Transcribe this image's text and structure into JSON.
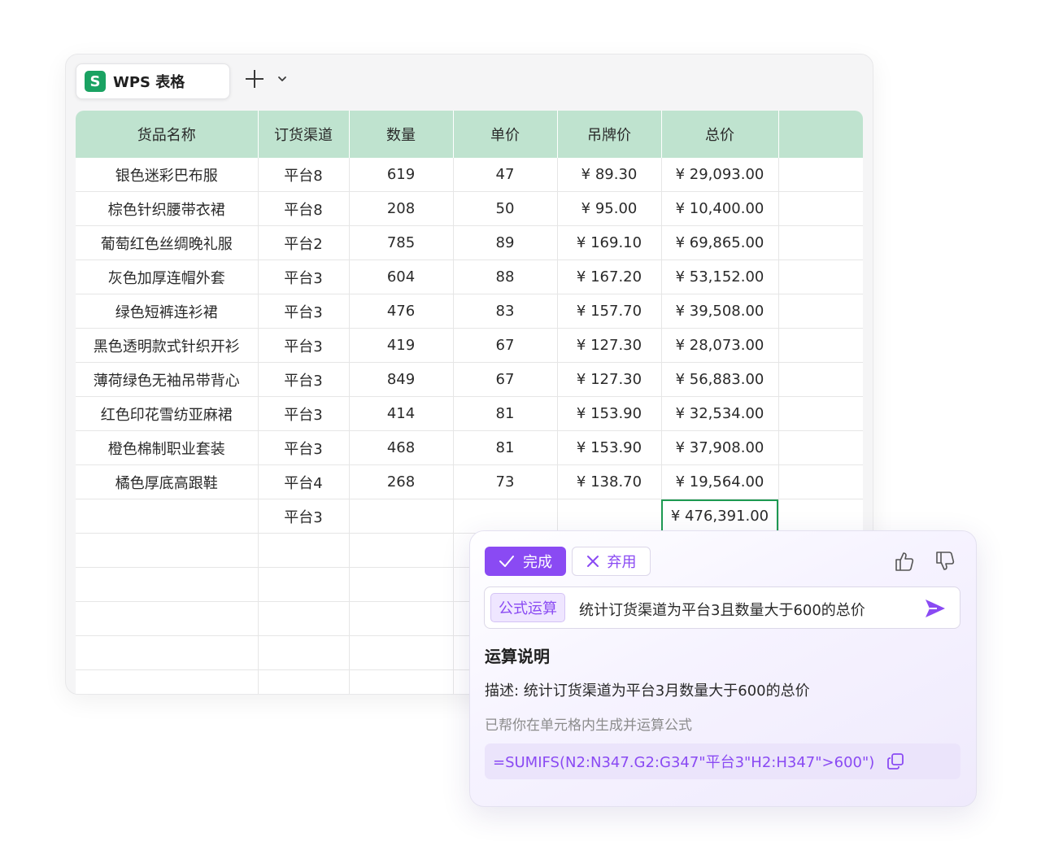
{
  "app": {
    "tab_title": "WPS 表格",
    "icon_letter": "S",
    "accent_green": "#1aa262"
  },
  "table": {
    "headers": [
      "货品名称",
      "订货渠道",
      "数量",
      "单价",
      "吊牌价",
      "总价",
      ""
    ],
    "rows": [
      [
        "银色迷彩巴布服",
        "平台8",
        "619",
        "47",
        "¥ 89.30",
        "¥ 29,093.00",
        ""
      ],
      [
        "棕色针织腰带衣裙",
        "平台8",
        "208",
        "50",
        "¥ 95.00",
        "¥ 10,400.00",
        ""
      ],
      [
        "葡萄红色丝绸晚礼服",
        "平台2",
        "785",
        "89",
        "¥ 169.10",
        "¥ 69,865.00",
        ""
      ],
      [
        "灰色加厚连帽外套",
        "平台3",
        "604",
        "88",
        "¥ 167.20",
        "¥ 53,152.00",
        ""
      ],
      [
        "绿色短裤连衫裙",
        "平台3",
        "476",
        "83",
        "¥ 157.70",
        "¥ 39,508.00",
        ""
      ],
      [
        "黑色透明款式针织开衫",
        "平台3",
        "419",
        "67",
        "¥ 127.30",
        "¥ 28,073.00",
        ""
      ],
      [
        "薄荷绿色无袖吊带背心",
        "平台3",
        "849",
        "67",
        "¥ 127.30",
        "¥ 56,883.00",
        ""
      ],
      [
        "红色印花雪纺亚麻裙",
        "平台3",
        "414",
        "81",
        "¥ 153.90",
        "¥ 32,534.00",
        ""
      ],
      [
        "橙色棉制职业套装",
        "平台3",
        "468",
        "81",
        "¥ 153.90",
        "¥ 37,908.00",
        ""
      ],
      [
        "橘色厚底高跟鞋",
        "平台4",
        "268",
        "73",
        "¥ 138.70",
        "¥ 19,564.00",
        ""
      ],
      [
        "",
        "平台3",
        "",
        "",
        "",
        "¥ 476,391.00",
        ""
      ],
      [
        "",
        "",
        "",
        "",
        "",
        "",
        ""
      ],
      [
        "",
        "",
        "",
        "",
        "",
        "",
        ""
      ],
      [
        "",
        "",
        "",
        "",
        "",
        "",
        ""
      ],
      [
        "",
        "",
        "",
        "",
        "",
        "",
        ""
      ],
      [
        "",
        "",
        "",
        "",
        "",
        "",
        ""
      ]
    ],
    "selected_cell": {
      "row": 10,
      "col": 5
    },
    "header_color": "#bfe3cf"
  },
  "assistant": {
    "done_label": "完成",
    "discard_label": "弃用",
    "mode_chip": "公式运算",
    "prompt": "统计订货渠道为平台3且数量大于600的总价",
    "section_title": "运算说明",
    "description": "描述: 统计订货渠道为平台3月数量大于600的总价",
    "note": "已帮你在单元格内生成并运算公式",
    "formula": "=SUMIFS(N2:N347.G2:G347\"平台3\"H2:H347\">600\")",
    "accent_purple": "#8a4af3"
  }
}
